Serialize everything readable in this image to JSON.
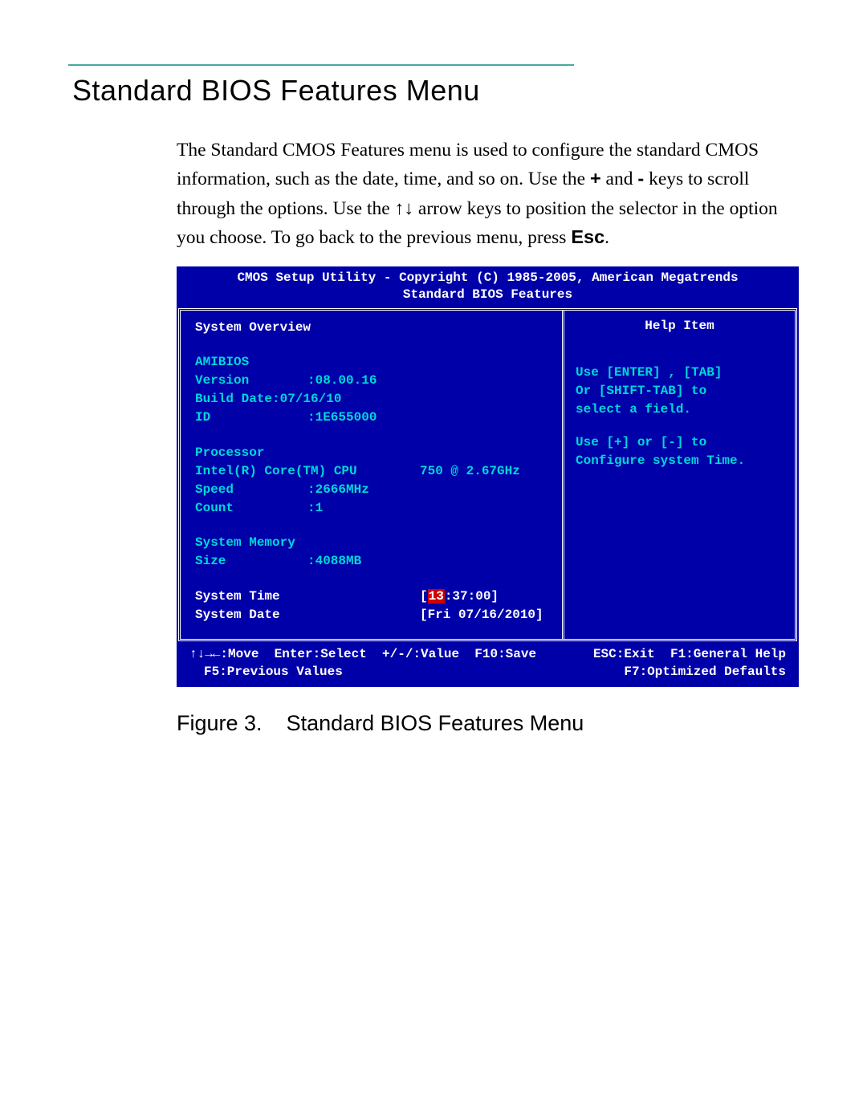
{
  "section": {
    "title": "Standard BIOS Features Menu"
  },
  "intro": {
    "line1": "The Standard CMOS Features menu is used to configure the standard CMOS information, such as the date, time, and so on. Use the ",
    "plus": "+",
    "and": " and ",
    "minus": "-",
    "line1b": " keys to scroll through the options. Use the ",
    "arrows": "↑↓",
    "line2": " arrow keys to position the selector in the option you choose. To go back to the previous menu, press ",
    "esc": "Esc",
    "period": "."
  },
  "bios": {
    "header1": "CMOS Setup Utility - Copyright (C) 1985-2005, American Megatrends",
    "header2": "Standard BIOS Features",
    "overview_label": "System Overview",
    "help_item": "Help Item",
    "amibios": "AMIBIOS",
    "version_label": "Version",
    "version_value": ":08.00.16",
    "build_label": "Build Date:07/16/10",
    "id_label": "ID",
    "id_value": ":1E655000",
    "processor": "Processor",
    "cpu_name": "Intel(R) Core(TM) CPU",
    "cpu_model": "750  @ 2.67GHz",
    "speed_label": "Speed",
    "speed_value": ":2666MHz",
    "count_label": "Count",
    "count_value": ":1",
    "memory": "System Memory",
    "size_label": "Size",
    "size_value": ":4088MB",
    "time_label": "System Time",
    "time_hours": "13",
    "time_rest": ":37:00]",
    "date_label": "System Date",
    "date_value": "[Fri 07/16/2010]",
    "help_line1": "Use [ENTER] , [TAB]",
    "help_line2": "Or [SHIFT-TAB] to",
    "help_line3": "select a field.",
    "help_line4": "Use [+] or [-] to",
    "help_line5": "Configure system Time.",
    "footer_move": "↑↓→←:Move",
    "footer_enter": "Enter:Select",
    "footer_value": "+/-/:Value",
    "footer_save": "F10:Save",
    "footer_exit": "ESC:Exit",
    "footer_help": "F1:General Help",
    "footer_f5": "F5:Previous Values",
    "footer_f7": "F7:Optimized Defaults"
  },
  "figure": {
    "label": "Figure 3.",
    "caption": "Standard BIOS Features Menu"
  }
}
